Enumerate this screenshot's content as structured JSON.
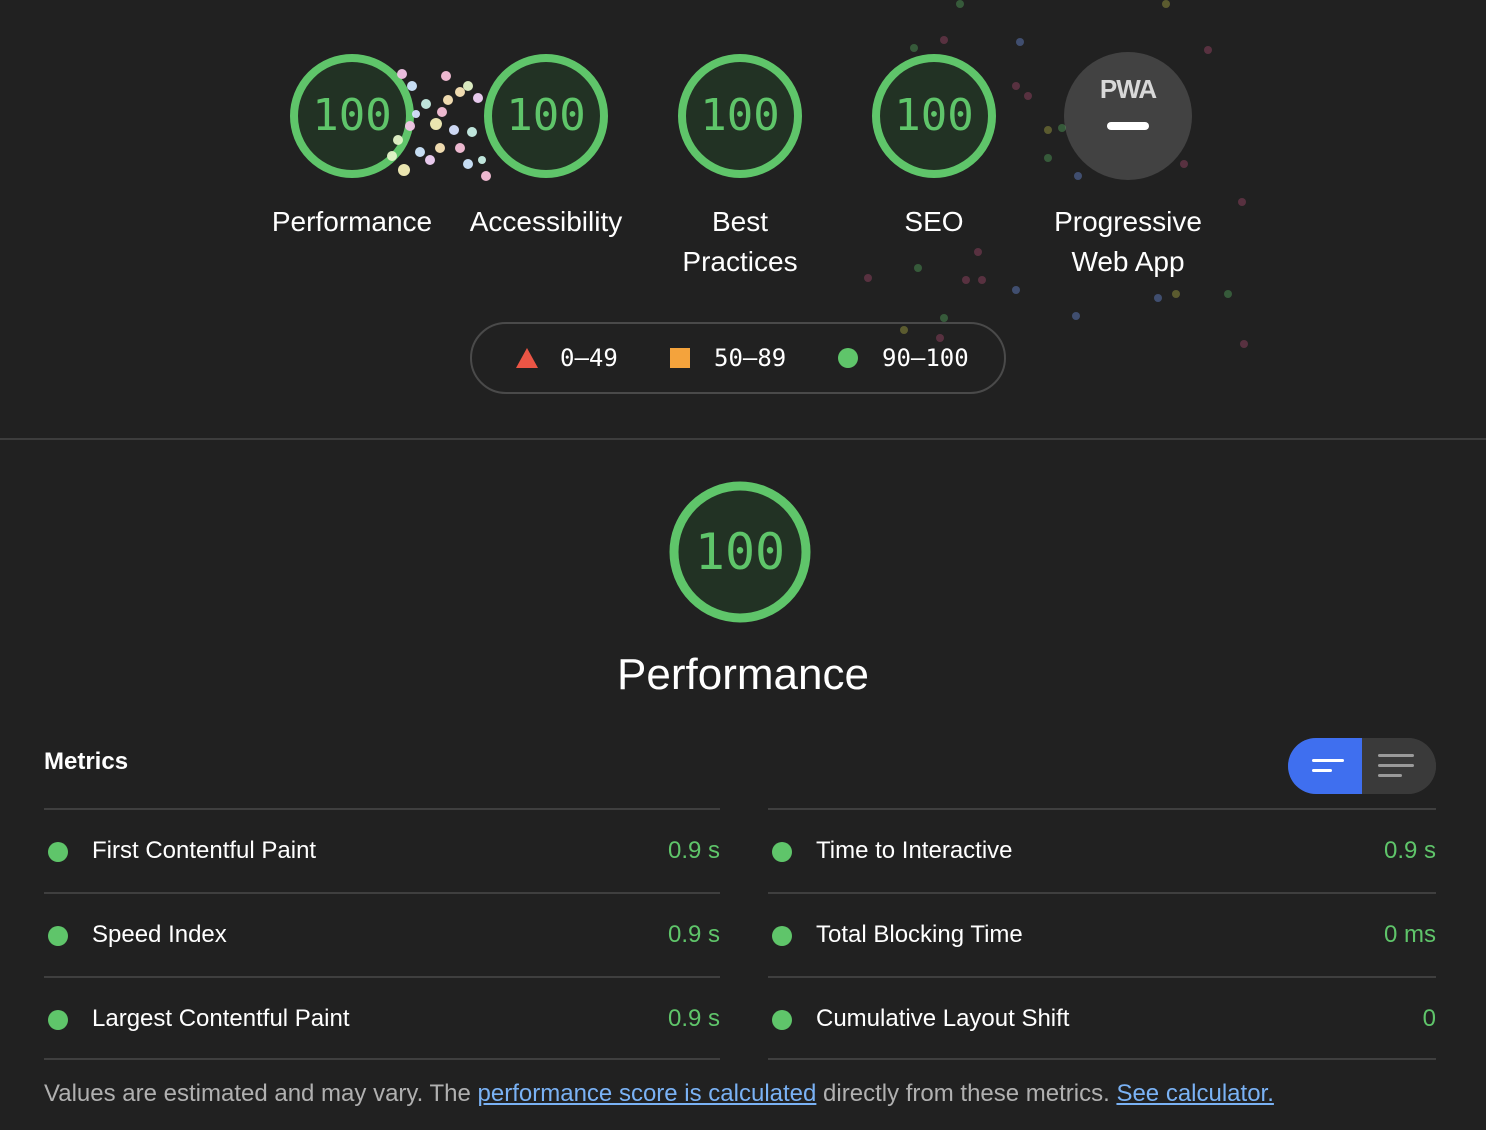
{
  "gauges": [
    {
      "score": "100",
      "label": "Performance"
    },
    {
      "score": "100",
      "label": "Accessibility"
    },
    {
      "score": "100",
      "label_line1": "Best",
      "label_line2": "Practices"
    },
    {
      "score": "100",
      "label": "SEO"
    }
  ],
  "pwa": {
    "logo": "PWA",
    "label_line1": "Progressive",
    "label_line2": "Web App"
  },
  "legend": {
    "fail": "0–49",
    "average": "50–89",
    "pass": "90–100"
  },
  "colors": {
    "pass": "#5fc56a",
    "average": "#f4a33c",
    "fail": "#eb5545",
    "accent": "#3f6fef"
  },
  "performance": {
    "score": "100",
    "title": "Performance"
  },
  "metrics": {
    "heading": "Metrics",
    "left": [
      {
        "name": "First Contentful Paint",
        "value": "0.9 s"
      },
      {
        "name": "Speed Index",
        "value": "0.9 s"
      },
      {
        "name": "Largest Contentful Paint",
        "value": "0.9 s"
      }
    ],
    "right": [
      {
        "name": "Time to Interactive",
        "value": "0.9 s"
      },
      {
        "name": "Total Blocking Time",
        "value": "0 ms"
      },
      {
        "name": "Cumulative Layout Shift",
        "value": "0"
      }
    ]
  },
  "footer": {
    "text1": "Values are estimated and may vary. The ",
    "link1": "performance score is calculated",
    "text2": " directly from these metrics. ",
    "link2": "See calculator."
  }
}
